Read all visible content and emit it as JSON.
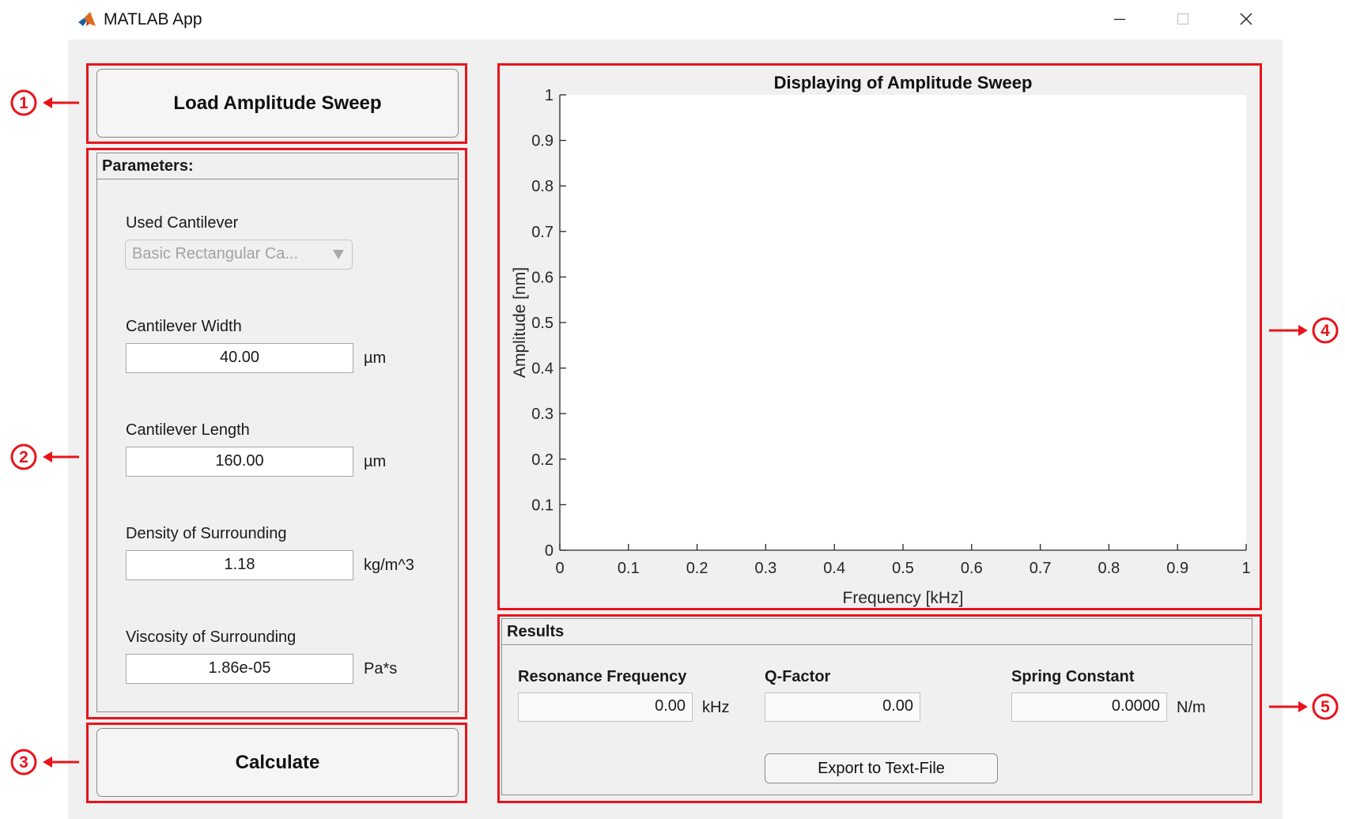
{
  "window": {
    "title": "MATLAB App",
    "icon": "matlab-logo-icon",
    "controls": [
      "minimize-icon",
      "maximize-icon",
      "close-icon"
    ]
  },
  "load_button": {
    "label": "Load Amplitude Sweep"
  },
  "parameters": {
    "title": "Parameters:",
    "cantilever": {
      "label": "Used Cantilever",
      "selected": "Basic Rectangular Ca..."
    },
    "width": {
      "label": "Cantilever Width",
      "value": "40.00",
      "unit": "µm"
    },
    "length": {
      "label": "Cantilever Length",
      "value": "160.00",
      "unit": "µm"
    },
    "density": {
      "label": "Density of Surrounding",
      "value": "1.18",
      "unit": "kg/m^3"
    },
    "viscosity": {
      "label": "Viscosity of Surrounding",
      "value": "1.86e-05",
      "unit": "Pa*s"
    }
  },
  "calculate_button": {
    "label": "Calculate"
  },
  "chart_data": {
    "type": "line",
    "title": "Displaying of Amplitude Sweep",
    "xlabel": "Frequency [kHz]",
    "ylabel": "Amplitude [nm]",
    "xlim": [
      0,
      1
    ],
    "ylim": [
      0,
      1
    ],
    "xticks": [
      "0",
      "0.1",
      "0.2",
      "0.3",
      "0.4",
      "0.5",
      "0.6",
      "0.7",
      "0.8",
      "0.9",
      "1"
    ],
    "yticks": [
      "0",
      "0.1",
      "0.2",
      "0.3",
      "0.4",
      "0.5",
      "0.6",
      "0.7",
      "0.8",
      "0.9",
      "1"
    ],
    "grid": false,
    "series": []
  },
  "results": {
    "title": "Results",
    "resonance": {
      "label": "Resonance Frequency",
      "value": "0.00",
      "unit": "kHz"
    },
    "qfactor": {
      "label": "Q-Factor",
      "value": "0.00"
    },
    "spring": {
      "label": "Spring Constant",
      "value": "0.0000",
      "unit": "N/m"
    },
    "export_label": "Export to Text-File"
  },
  "annotations": {
    "callouts": [
      "①",
      "②",
      "③",
      "④",
      "⑤"
    ],
    "color": "#e8141b"
  },
  "colors": {
    "window_bg": "#f0f0f0",
    "annotation_red": "#e8141b"
  }
}
